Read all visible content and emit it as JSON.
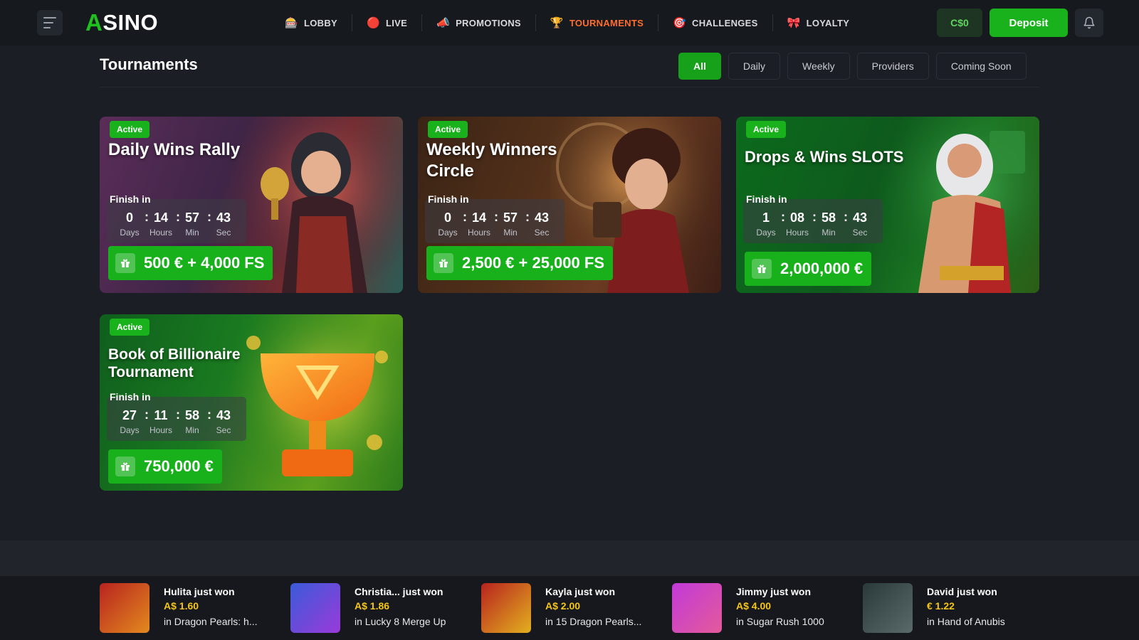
{
  "header": {
    "logo": "ASINO",
    "logo_mark": "A",
    "logo_rest": "SINO",
    "nav": [
      {
        "label": "LOBBY",
        "icon": "slot-machine-icon"
      },
      {
        "label": "LIVE",
        "icon": "live-icon"
      },
      {
        "label": "PROMOTIONS",
        "icon": "megaphone-icon"
      },
      {
        "label": "TOURNAMENTS",
        "icon": "trophy-icon",
        "active": true
      },
      {
        "label": "CHALLENGES",
        "icon": "target-icon"
      },
      {
        "label": "LOYALTY",
        "icon": "bow-icon"
      }
    ],
    "balance": "C$0",
    "deposit_label": "Deposit"
  },
  "page": {
    "title": "Tournaments",
    "filters": [
      "All",
      "Daily",
      "Weekly",
      "Providers",
      "Coming Soon"
    ],
    "active_filter": "All"
  },
  "labels": {
    "finish_in": "Finish in",
    "days": "Days",
    "hours": "Hours",
    "min": "Min",
    "sec": "Sec"
  },
  "tournaments": [
    {
      "status": "Active",
      "title": "Daily Wins Rally",
      "days": "0",
      "hours": "14",
      "min": "57",
      "sec": "43",
      "prize": "500 € + 4,000 FS"
    },
    {
      "status": "Active",
      "title": "Weekly Winners Circle",
      "days": "0",
      "hours": "14",
      "min": "57",
      "sec": "43",
      "prize": "2,500 € + 25,000 FS"
    },
    {
      "status": "Active",
      "title": "Drops & Wins SLOTS",
      "days": "1",
      "hours": "08",
      "min": "58",
      "sec": "43",
      "prize": "2,000,000 €"
    },
    {
      "status": "Active",
      "title": "Book of Billionaire Tournament",
      "days": "27",
      "hours": "11",
      "min": "58",
      "sec": "43",
      "prize": "750,000 €"
    }
  ],
  "winners": [
    {
      "name": "Hulita just won",
      "amount": "A$ 1.60",
      "game": "in Dragon Pearls: h..."
    },
    {
      "name": "Christia... just won",
      "amount": "A$ 1.86",
      "game": "in Lucky 8 Merge Up"
    },
    {
      "name": "Kayla just won",
      "amount": "A$ 2.00",
      "game": "in 15 Dragon Pearls..."
    },
    {
      "name": "Jimmy just won",
      "amount": "A$ 4.00",
      "game": "in Sugar Rush 1000"
    },
    {
      "name": "David just won",
      "amount": "€ 1.22",
      "game": "in Hand of Anubis"
    }
  ],
  "colors": {
    "accent_green": "#19b21d",
    "active_nav": "#ff6d2e",
    "amount_gold": "#f5c518"
  }
}
